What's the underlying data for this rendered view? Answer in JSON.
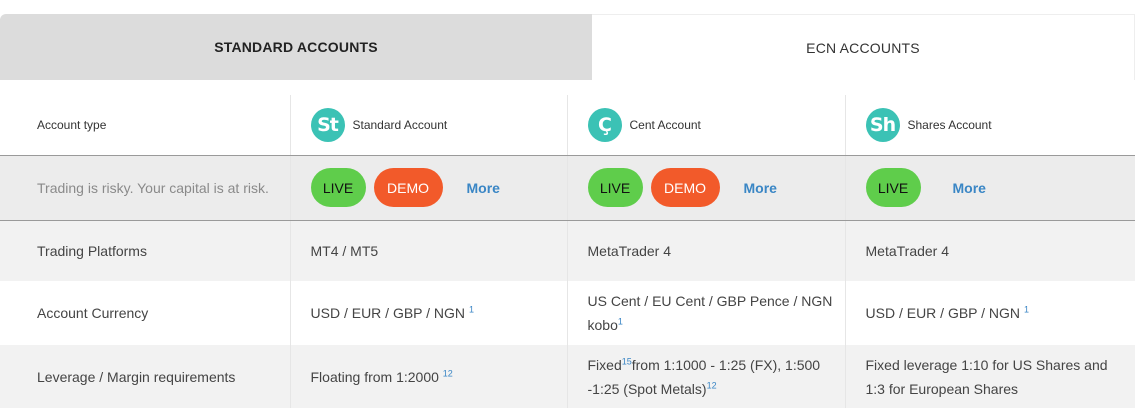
{
  "tabs": {
    "standard": "STANDARD ACCOUNTS",
    "ecn": "ECN ACCOUNTS"
  },
  "table": {
    "header_label": "Account type",
    "accounts": [
      {
        "icon_text": "St",
        "icon_name": "standard-account-icon",
        "name": "Standard Account"
      },
      {
        "icon_text": "Ç",
        "icon_name": "cent-account-icon",
        "name": "Cent Account"
      },
      {
        "icon_text": "Sh",
        "icon_name": "shares-account-icon",
        "name": "Shares Account"
      }
    ],
    "risk_text": "Trading is risky. Your capital is at risk.",
    "buttons": {
      "live": "LIVE",
      "demo": "DEMO",
      "more": "More"
    },
    "rows": {
      "platforms": {
        "label": "Trading Platforms",
        "values": [
          "MT4 / MT5",
          "MetaTrader 4",
          "MetaTrader 4"
        ]
      },
      "currency": {
        "label": "Account Currency",
        "standard": "USD / EUR / GBP / NGN ",
        "standard_sup": "1",
        "cent": "US Cent / EU Cent / GBP Pence / NGN kobo",
        "cent_sup": "1",
        "shares": "USD / EUR / GBP / NGN ",
        "shares_sup": "1"
      },
      "leverage": {
        "label": "Leverage / Margin requirements",
        "standard": "Floating from 1:2000 ",
        "standard_sup": "12",
        "cent_a": "Fixed",
        "cent_sup_a": "15",
        "cent_b": "from 1:1000 - 1:25 (FX), 1:500 -1:25 (Spot Metals)",
        "cent_sup_b": "12",
        "shares": "Fixed leverage 1:10 for US Shares and 1:3 for European Shares"
      }
    }
  },
  "colors": {
    "live": "#5fcd4b",
    "demo": "#f25a2a",
    "more_link": "#3a86c5",
    "icon": "#3bc2b5",
    "active_tab": "#dcdcdc"
  }
}
